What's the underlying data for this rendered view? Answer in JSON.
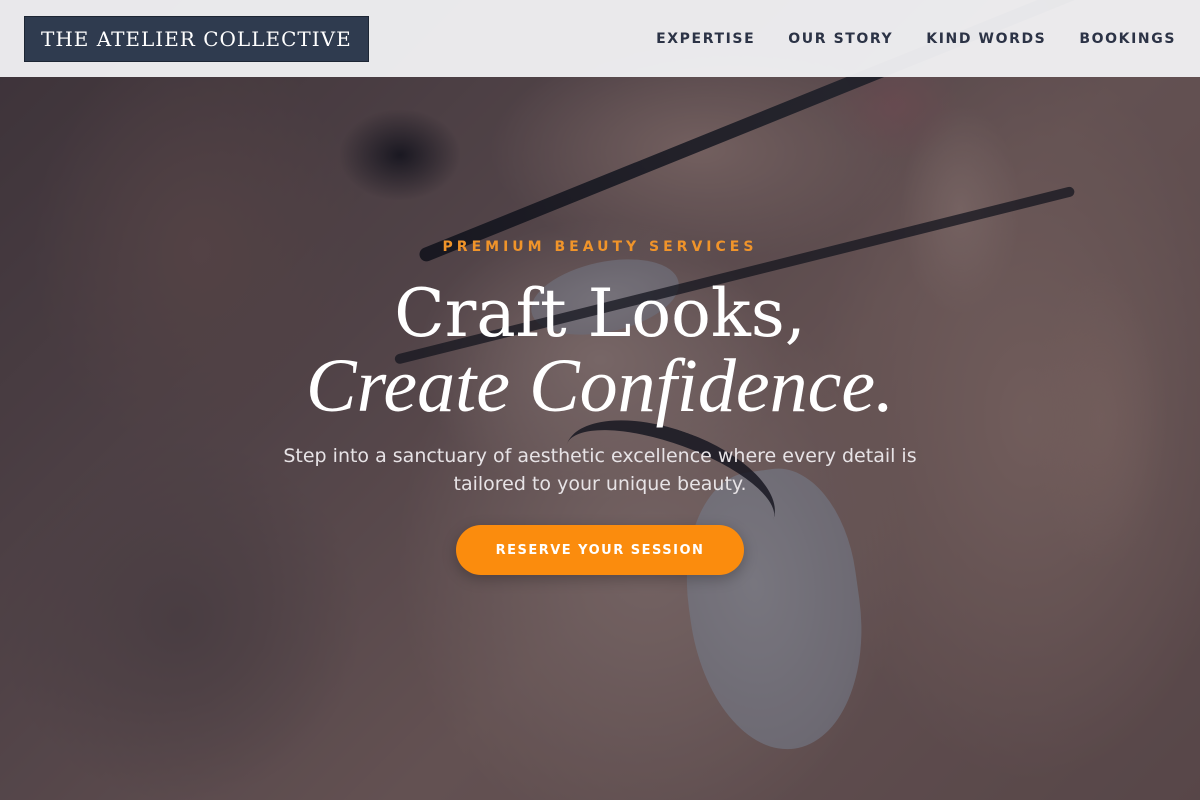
{
  "brand": {
    "logo_text": "THE ATELIER COLLECTIVE"
  },
  "nav": {
    "items": [
      {
        "label": "EXPERTISE"
      },
      {
        "label": "OUR STORY"
      },
      {
        "label": "KIND WORDS"
      },
      {
        "label": "BOOKINGS"
      }
    ]
  },
  "hero": {
    "eyebrow": "PREMIUM BEAUTY SERVICES",
    "headline_line1": "Craft Looks,",
    "headline_line2": "Create Confidence.",
    "subtitle": "Step into a sanctuary of aesthetic excellence where every detail is tailored to your unique beauty.",
    "cta_label": "RESERVE YOUR SESSION",
    "background_description_icon": "lash-extension-photo"
  },
  "colors": {
    "accent": "#fb8c0d",
    "eyebrow": "#f0942a",
    "logo_bg": "#2f3b4f",
    "nav_text": "#2c3346",
    "header_bg": "#f2f2f4"
  }
}
